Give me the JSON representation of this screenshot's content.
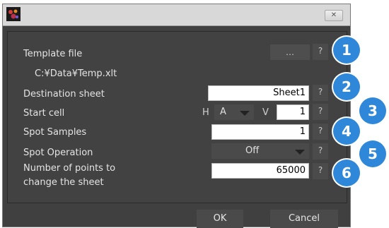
{
  "window": {
    "close_symbol": "✕"
  },
  "template_file": {
    "label": "Template file",
    "browse_label": "…",
    "help_label": "?",
    "path": "C:¥Data¥Temp.xlt"
  },
  "destination_sheet": {
    "label": "Destination sheet",
    "value": "Sheet1",
    "help_label": "?"
  },
  "start_cell": {
    "label": "Start cell",
    "h_label": "H",
    "h_value": "A",
    "v_label": "V",
    "v_value": "1",
    "help_label": "?"
  },
  "spot_samples": {
    "label": "Spot Samples",
    "value": "1",
    "help_label": "?"
  },
  "spot_operation": {
    "label": "Spot Operation",
    "value": "Off",
    "help_label": "?"
  },
  "points_to_change": {
    "label_line1": "Number of points to",
    "label_line2": "change the sheet",
    "value": "65000",
    "help_label": "?"
  },
  "footer": {
    "ok_label": "OK",
    "cancel_label": "Cancel"
  },
  "badges": [
    "1",
    "2",
    "3",
    "4",
    "5",
    "6"
  ],
  "colors": {
    "badge": "#2e87d8",
    "window_bg": "#404040"
  }
}
